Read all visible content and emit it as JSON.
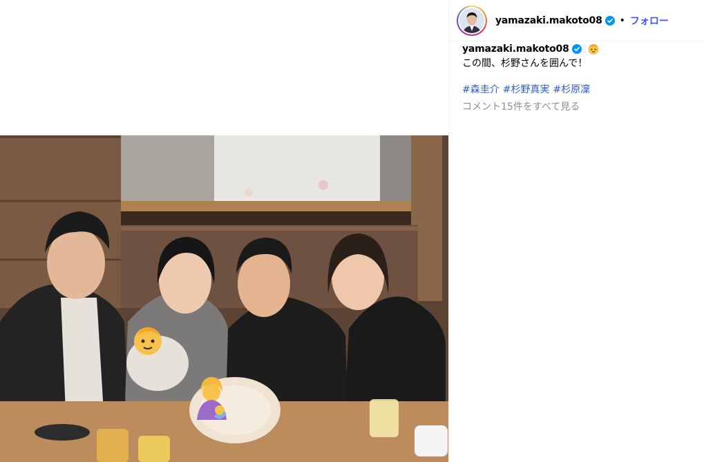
{
  "post": {
    "username": "yamazaki.makoto08",
    "follow_label": "フォロー",
    "separator": "•",
    "caption_user": "yamazaki.makoto08",
    "caption_text": "この間、杉野さんを囲んで！",
    "hashtags": [
      "#森圭介",
      "#杉野真実",
      "#杉原凜"
    ],
    "comments_link": "コメント15件をすべて見る"
  },
  "colors": {
    "follow": "#4150f7",
    "hashtag": "#2b5dd1",
    "verified": "#0095f6",
    "muted": "#8e8e8e"
  },
  "icons": {
    "verified": "verified-badge-icon",
    "caption_emoji": "baby-emoji-icon",
    "baby_sticker": "baby-face-emoji",
    "mother_sticker": "breastfeeding-emoji"
  }
}
